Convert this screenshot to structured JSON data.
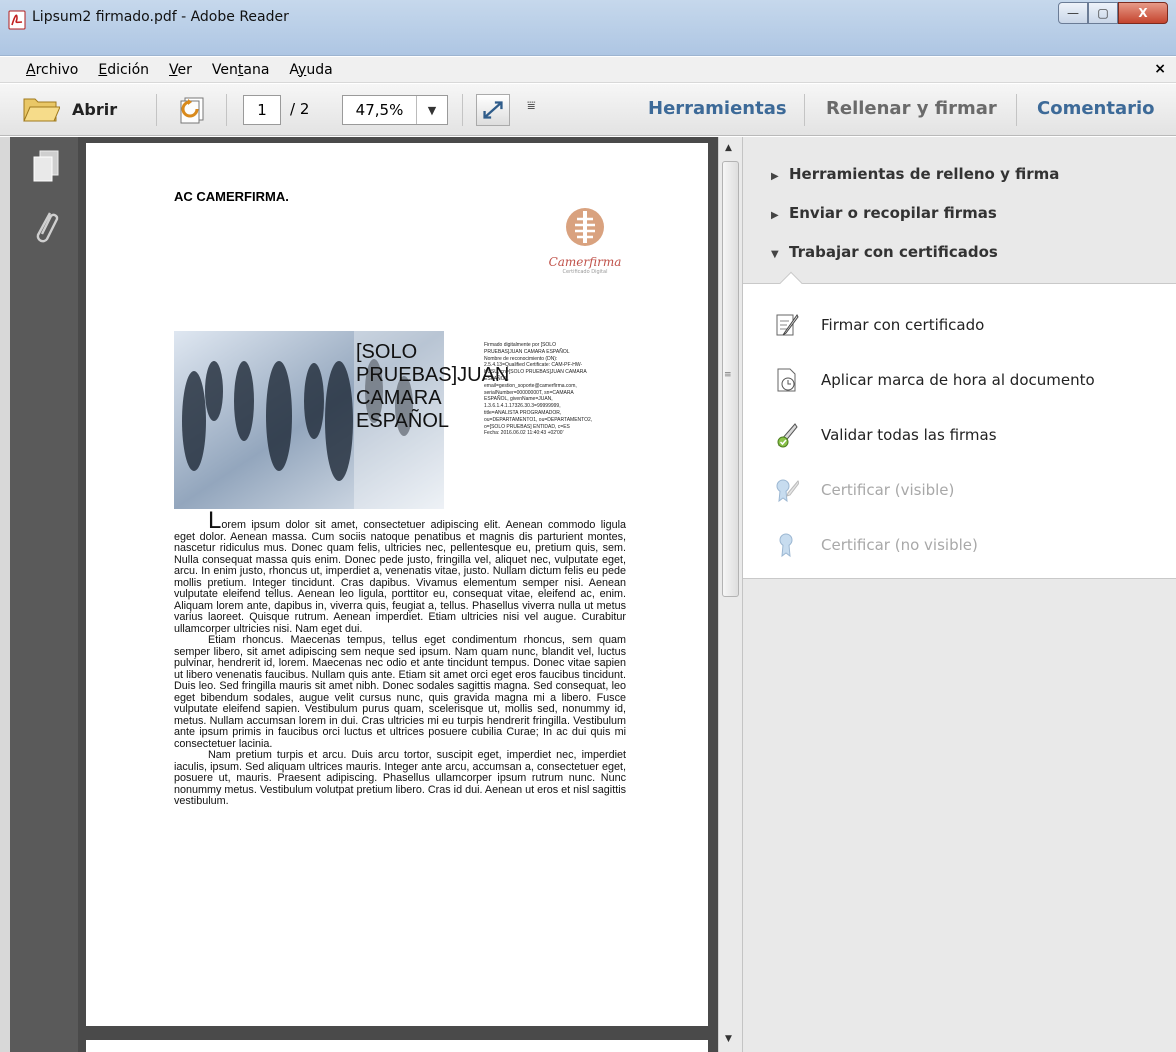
{
  "window": {
    "title": "Lipsum2 firmado.pdf - Adobe Reader",
    "controls": {
      "minimize": "—",
      "maximize": "▢",
      "close": "X"
    }
  },
  "menu": {
    "items": [
      {
        "label": "Archivo",
        "accel": "A",
        "rest": "rchivo"
      },
      {
        "label": "Edición",
        "accel": "E",
        "rest": "dición"
      },
      {
        "label": "Ver",
        "accel": "V",
        "rest": "er"
      },
      {
        "label": "Ventana",
        "accel": "t",
        "pre": "Ven",
        "rest": "ana"
      },
      {
        "label": "Ayuda",
        "accel": "y",
        "pre": "A",
        "rest": "uda"
      }
    ],
    "close": "×"
  },
  "toolbar": {
    "open_label": "Abrir",
    "page_current": "1",
    "page_total": "/ 2",
    "zoom": "47,5%",
    "more": "⩸",
    "links": {
      "tools": "Herramientas",
      "fill_sign": "Rellenar y firmar",
      "comment": "Comentario"
    }
  },
  "document": {
    "company": "AC CAMERFIRMA.",
    "logo_brand": "Camerfirma",
    "logo_tagline": "Certificado Digital",
    "signature_big": "[SOLO PRUEBAS]JUAN CAMARA ESPAÑOL",
    "signature_details": "Firmado digitalmente por [SOLO\nPRUEBAS]JUAN CAMARA ESPAÑOL\nNombre de reconocimiento (DN):\n2.5.4.13=Qualified Certificate: CAM-PF-HW-\nKUSU, cn=[SOLO PRUEBAS]JUAN CAMARA\nESPAÑOL,\nemail=gestion_soporte@camerfirma.com,\nserialNumber=00000000T, sn=CAMARA\nESPAÑOL, givenName=JUAN,\n1.3.6.1.4.1.17326.30.3=99999999,\ntitle=ANALISTA PROGRAMADOR,\nou=DEPARTAMENTO1, ou=DEPARTAMENTO2,\no=[SOLO PRUEBAS] ENTIDAD, c=ES\nFecha: 2016.06.02 11:40:43 +02'00'",
    "dropcap": "L",
    "paragraph1": "orem ipsum dolor sit amet, consectetuer adipiscing elit. Aenean commodo ligula eget dolor. Aenean massa. Cum sociis natoque penatibus et magnis dis parturient montes, nascetur ridiculus mus. Donec quam felis, ultricies nec, pellentesque eu, pretium quis, sem. Nulla consequat massa quis enim. Donec pede justo, fringilla vel, aliquet nec, vulputate eget, arcu. In enim justo, rhoncus ut, imperdiet a, venenatis vitae, justo. Nullam dictum felis eu pede mollis pretium. Integer tincidunt. Cras dapibus. Vivamus elementum semper nisi. Aenean vulputate eleifend tellus. Aenean leo ligula, porttitor eu, consequat vitae, eleifend ac, enim. Aliquam lorem ante, dapibus in, viverra quis, feugiat a, tellus. Phasellus viverra nulla ut metus varius laoreet. Quisque rutrum. Aenean imperdiet. Etiam ultricies nisi vel augue. Curabitur ullamcorper ultricies nisi. Nam eget dui.",
    "paragraph2": "Etiam rhoncus. Maecenas tempus, tellus eget condimentum rhoncus, sem quam semper libero, sit amet adipiscing sem neque sed ipsum. Nam quam nunc, blandit vel, luctus pulvinar, hendrerit id, lorem. Maecenas nec odio et ante tincidunt tempus. Donec vitae sapien ut libero venenatis faucibus. Nullam quis ante. Etiam sit amet orci eget eros faucibus tincidunt. Duis leo. Sed fringilla mauris sit amet nibh. Donec sodales sagittis magna. Sed consequat, leo eget bibendum sodales, augue velit cursus nunc, quis gravida magna mi a libero. Fusce vulputate eleifend sapien. Vestibulum purus quam, scelerisque ut, mollis sed, nonummy id, metus. Nullam accumsan lorem in dui. Cras ultricies mi eu turpis hendrerit fringilla. Vestibulum ante ipsum primis in faucibus orci luctus et ultrices posuere cubilia Curae; In ac dui quis mi consectetuer lacinia.",
    "paragraph3": "Nam pretium turpis et arcu. Duis arcu tortor, suscipit eget, imperdiet nec, imperdiet iaculis, ipsum. Sed aliquam ultrices mauris. Integer ante arcu, accumsan a, consectetuer eget, posuere ut, mauris. Praesent adipiscing. Phasellus ullamcorper ipsum rutrum nunc. Nunc nonummy metus. Vestibulum volutpat pretium libero. Cras id dui. Aenean ut eros et nisl sagittis vestibulum."
  },
  "tools_pane": {
    "sections": [
      {
        "label": "Herramientas de relleno y firma",
        "expanded": false
      },
      {
        "label": "Enviar o recopilar firmas",
        "expanded": false
      },
      {
        "label": "Trabajar con certificados",
        "expanded": true
      }
    ],
    "tools": [
      {
        "label": "Firmar con certificado",
        "icon": "pen-sign-icon",
        "enabled": true
      },
      {
        "label": "Aplicar marca de hora al documento",
        "icon": "timestamp-clock-icon",
        "enabled": true
      },
      {
        "label": "Validar todas las firmas",
        "icon": "validate-pen-icon",
        "enabled": true
      },
      {
        "label": "Certificar (visible)",
        "icon": "certify-ribbon-pen-icon",
        "enabled": false
      },
      {
        "label": "Certificar (no visible)",
        "icon": "certify-ribbon-icon",
        "enabled": false
      }
    ]
  },
  "colors": {
    "link_blue": "#3d6a98",
    "link_gray": "#6a6a6a",
    "brand": "#c0524a"
  }
}
